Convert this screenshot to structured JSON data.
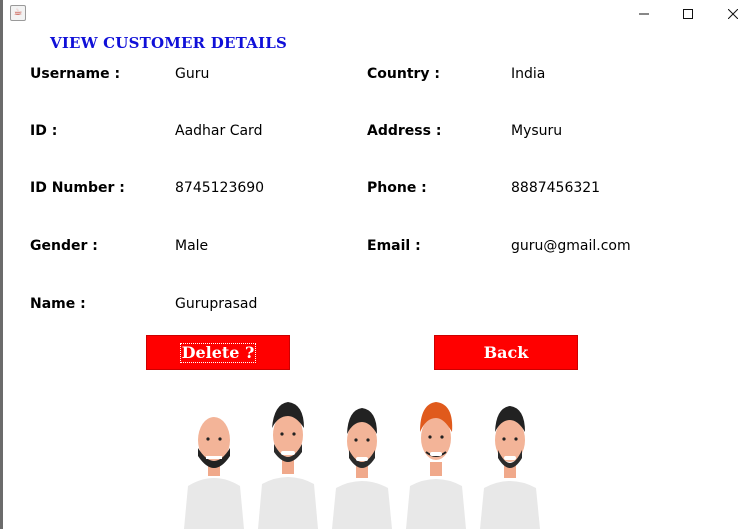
{
  "window": {
    "minimize_icon": "minimize-icon",
    "maximize_icon": "maximize-icon",
    "close_icon": "close-icon",
    "app_icon": "java-icon"
  },
  "heading": "VIEW CUSTOMER DETAILS",
  "fields": {
    "username": {
      "label": "Username :",
      "value": "Guru"
    },
    "id": {
      "label": "ID :",
      "value": "Aadhar Card"
    },
    "id_number": {
      "label": "ID Number :",
      "value": "8745123690"
    },
    "gender": {
      "label": "Gender :",
      "value": "Male"
    },
    "name": {
      "label": "Name :",
      "value": "Guruprasad"
    },
    "country": {
      "label": "Country :",
      "value": "India"
    },
    "address": {
      "label": "Address :",
      "value": "Mysuru"
    },
    "phone": {
      "label": "Phone :",
      "value": "8887456321"
    },
    "email": {
      "label": "Email :",
      "value": "guru@gmail.com"
    }
  },
  "buttons": {
    "delete": "Delete ?",
    "back": "Back"
  },
  "colors": {
    "heading": "#1010d8",
    "button_bg": "#ff0000",
    "button_text": "#ffffff"
  },
  "illustration": "group-of-five-men-illustration"
}
